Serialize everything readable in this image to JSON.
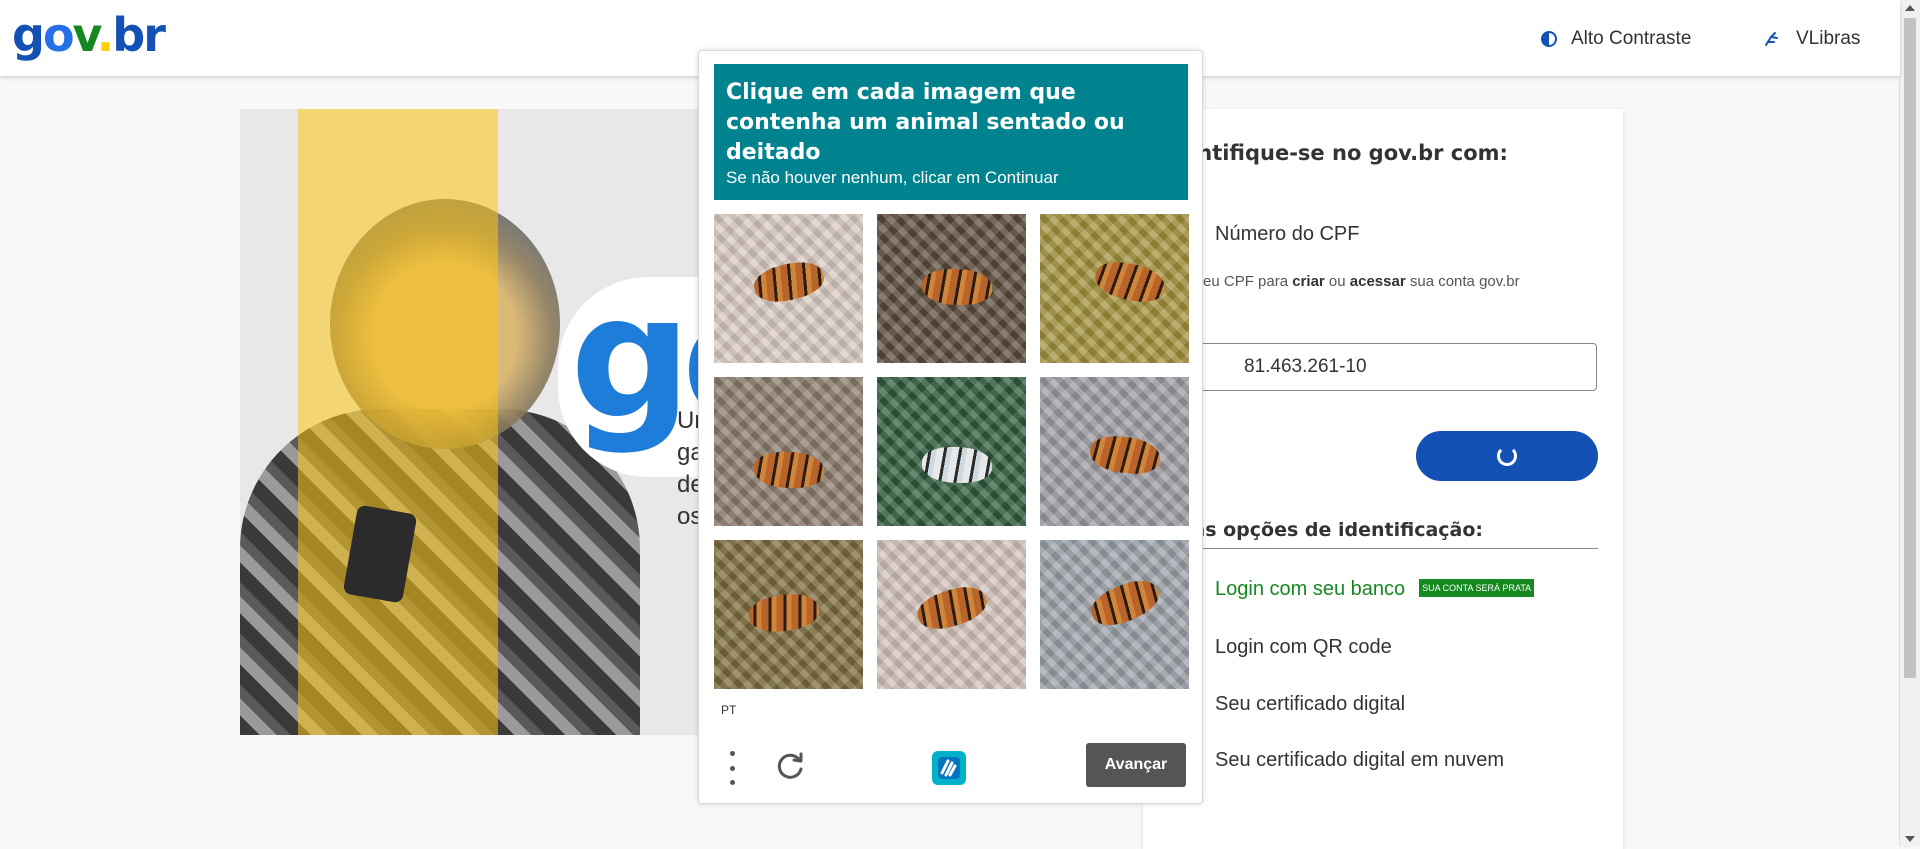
{
  "header": {
    "logo": {
      "g": "g",
      "o": "o",
      "v": "v",
      "dot": ".",
      "br": "br"
    },
    "contrast_label": "Alto Contraste",
    "vlibras_label": "VLibras"
  },
  "promo": {
    "big_letters": "go",
    "text_lines": [
      "Un",
      "ga",
      "de",
      "os"
    ]
  },
  "login": {
    "title": "entifique-se no gov.br com:",
    "cpf_option": "Número do CPF",
    "cpf_help_pre": "e seu CPF para ",
    "cpf_help_criar": "criar",
    "cpf_help_mid": " ou ",
    "cpf_help_acessar": "acessar",
    "cpf_help_post": " sua conta gov.br",
    "cpf_label": ":",
    "cpf_value": "81.463.261-10",
    "other_title": "ras opções de identificação:",
    "options": [
      {
        "label": "Login com seu banco",
        "badge": "SUA CONTA SERÁ PRATA"
      },
      {
        "label": "Login com QR code"
      },
      {
        "label": "Seu certificado digital"
      },
      {
        "label": "Seu certificado digital em nuvem"
      }
    ]
  },
  "captcha": {
    "question": "Clique em cada imagem que contenha um animal sentado ou deitado",
    "subtitle": "Se não houver nenhum, clicar em Continuar",
    "language": "PT",
    "next_label": "Avançar",
    "accent_color": "#00838f",
    "tiles": [
      {
        "subject": "leaping tiger",
        "bg": "#d8c8c0"
      },
      {
        "subject": "tiger on rock",
        "bg": "#5a4a3a"
      },
      {
        "subject": "running tiger",
        "bg": "#a0903a"
      },
      {
        "subject": "lying tiger",
        "bg": "#8a7a6a"
      },
      {
        "subject": "lying white tiger",
        "bg": "#2f5a3a"
      },
      {
        "subject": "lying tiger",
        "bg": "#9a9aa0"
      },
      {
        "subject": "running tiger",
        "bg": "#7a6a3a"
      },
      {
        "subject": "leaping tiger",
        "bg": "#d0c0b8"
      },
      {
        "subject": "leaping tiger",
        "bg": "#9aa0a8"
      }
    ]
  }
}
